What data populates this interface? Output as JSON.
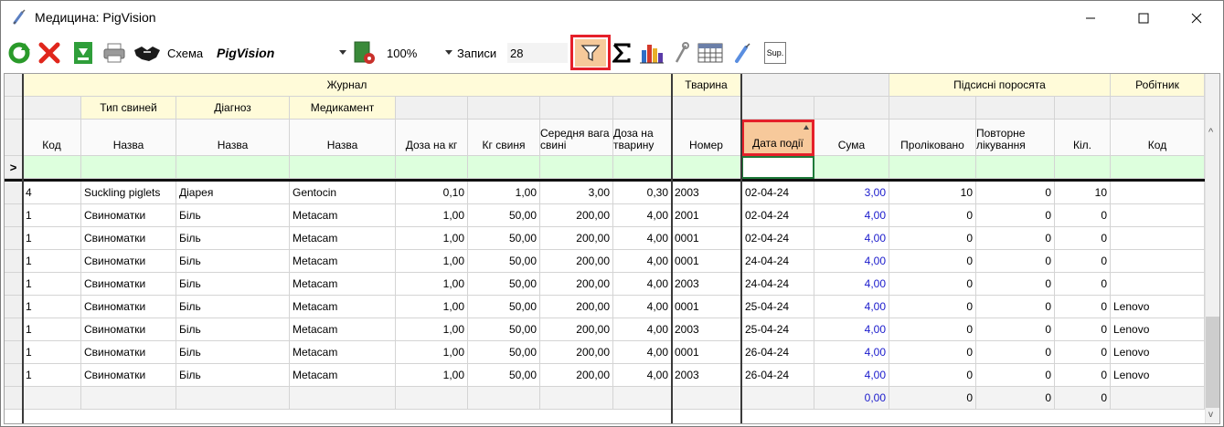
{
  "window": {
    "title": "Медицина: PigVision"
  },
  "toolbar": {
    "schema_label": "Схема",
    "schema_value": "PigVision",
    "zoom_value": "100%",
    "records_label": "Записи",
    "records_value": "28",
    "sup_label": "Sup."
  },
  "grid": {
    "groups": {
      "journal": "Журнал",
      "animal": "Тварина",
      "piglets": "Підсисні поросята",
      "worker": "Робітник"
    },
    "subgroups": {
      "pig_type": "Тип свиней",
      "diagnosis": "Діагноз",
      "medicine": "Медикамент"
    },
    "columns": [
      "Код",
      "Назва",
      "Назва",
      "Назва",
      "Доза на кг",
      "Кг свиня",
      "Середня вага свині",
      "Доза на тварину",
      "Номер",
      "Дата події",
      "Сума",
      "Проліковано",
      "Повторне лікування",
      "Кіл.",
      "Код"
    ],
    "rows": [
      [
        "4",
        "Suckling piglets",
        "Діарея",
        "Gentocin",
        "0,10",
        "1,00",
        "3,00",
        "0,30",
        "2003",
        "02-04-24",
        "3,00",
        "10",
        "0",
        "10",
        ""
      ],
      [
        "1",
        "Свиноматки",
        "Біль",
        "Metacam",
        "1,00",
        "50,00",
        "200,00",
        "4,00",
        "2001",
        "02-04-24",
        "4,00",
        "0",
        "0",
        "0",
        ""
      ],
      [
        "1",
        "Свиноматки",
        "Біль",
        "Metacam",
        "1,00",
        "50,00",
        "200,00",
        "4,00",
        "0001",
        "02-04-24",
        "4,00",
        "0",
        "0",
        "0",
        ""
      ],
      [
        "1",
        "Свиноматки",
        "Біль",
        "Metacam",
        "1,00",
        "50,00",
        "200,00",
        "4,00",
        "0001",
        "24-04-24",
        "4,00",
        "0",
        "0",
        "0",
        ""
      ],
      [
        "1",
        "Свиноматки",
        "Біль",
        "Metacam",
        "1,00",
        "50,00",
        "200,00",
        "4,00",
        "2003",
        "24-04-24",
        "4,00",
        "0",
        "0",
        "0",
        ""
      ],
      [
        "1",
        "Свиноматки",
        "Біль",
        "Metacam",
        "1,00",
        "50,00",
        "200,00",
        "4,00",
        "0001",
        "25-04-24",
        "4,00",
        "0",
        "0",
        "0",
        "Lenovo"
      ],
      [
        "1",
        "Свиноматки",
        "Біль",
        "Metacam",
        "1,00",
        "50,00",
        "200,00",
        "4,00",
        "2003",
        "25-04-24",
        "4,00",
        "0",
        "0",
        "0",
        "Lenovo"
      ],
      [
        "1",
        "Свиноматки",
        "Біль",
        "Metacam",
        "1,00",
        "50,00",
        "200,00",
        "4,00",
        "0001",
        "26-04-24",
        "4,00",
        "0",
        "0",
        "0",
        "Lenovo"
      ],
      [
        "1",
        "Свиноматки",
        "Біль",
        "Metacam",
        "1,00",
        "50,00",
        "200,00",
        "4,00",
        "2003",
        "26-04-24",
        "4,00",
        "0",
        "0",
        "0",
        "Lenovo"
      ]
    ],
    "totals": {
      "sum": "0,00",
      "treated": "0",
      "repeat": "0",
      "count": "0"
    },
    "filter_row_marker": ">",
    "accent_colors": {
      "highlight": "#e5202a",
      "filter_row": "#ddffdd",
      "group_header": "#fffbd9",
      "sum_text": "#1a1acc"
    }
  }
}
